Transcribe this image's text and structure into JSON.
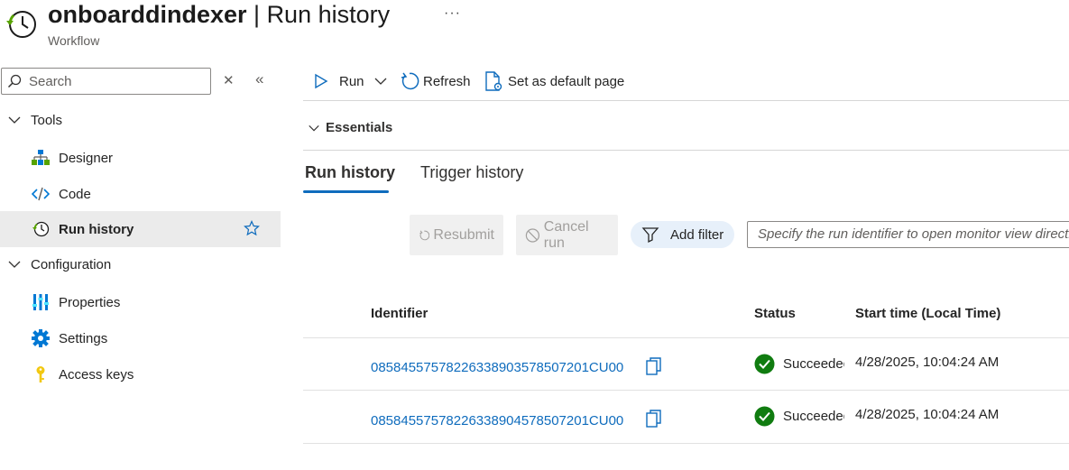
{
  "header": {
    "name": "onboarddindexer",
    "separator": " | ",
    "section": "Run history",
    "subtitle": "Workflow",
    "more": "···"
  },
  "sidebar": {
    "search_placeholder": "Search",
    "groups": [
      {
        "label": "Tools",
        "items": [
          {
            "label": "Designer",
            "icon": "designer-icon"
          },
          {
            "label": "Code",
            "icon": "code-icon"
          },
          {
            "label": "Run history",
            "icon": "run-history-icon",
            "active": true
          }
        ]
      },
      {
        "label": "Configuration",
        "items": [
          {
            "label": "Properties",
            "icon": "properties-icon"
          },
          {
            "label": "Settings",
            "icon": "settings-gear-icon"
          },
          {
            "label": "Access keys",
            "icon": "key-icon"
          }
        ]
      }
    ]
  },
  "toolbar": {
    "run_label": "Run",
    "refresh_label": "Refresh",
    "default_page_label": "Set as default page"
  },
  "essentials": {
    "label": "Essentials"
  },
  "tabs": [
    {
      "label": "Run history",
      "selected": true
    },
    {
      "label": "Trigger history",
      "selected": false
    }
  ],
  "actions": {
    "resubmit_label": "Resubmit",
    "cancel_label": "Cancel run",
    "filter_label": "Add filter",
    "run_id_placeholder": "Specify the run identifier to open monitor view directly"
  },
  "table": {
    "columns": [
      "Identifier",
      "Status",
      "Start time (Local Time)"
    ],
    "rows": [
      {
        "identifier": "08584557578226338903578507201CU00",
        "status": "Succeeded",
        "start_time": "4/28/2025, 10:04:24 AM"
      },
      {
        "identifier": "08584557578226338904578507201CU00",
        "status": "Succeeded",
        "start_time": "4/28/2025, 10:04:24 AM"
      }
    ]
  },
  "colors": {
    "accent": "#0f6cbd",
    "success": "#107c10",
    "active_bg": "#ebebeb"
  }
}
